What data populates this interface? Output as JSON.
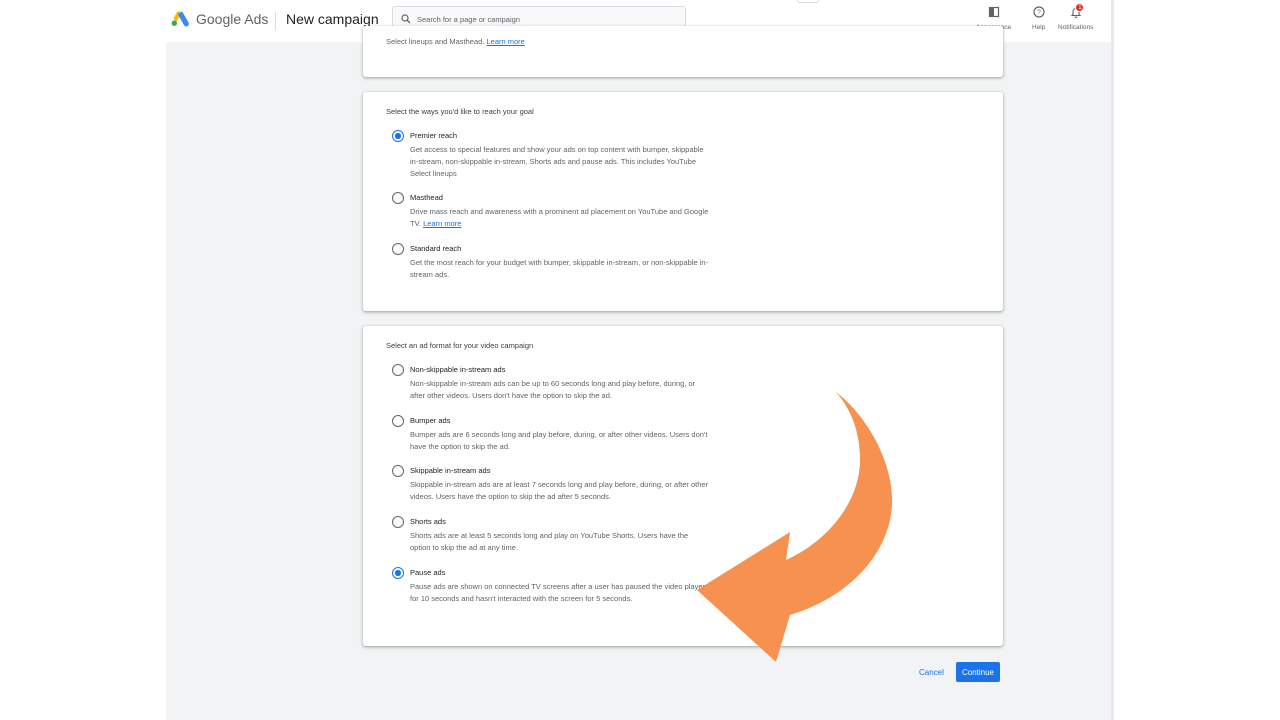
{
  "header": {
    "brand": "Google Ads",
    "page_title": "New campaign",
    "search_placeholder": "Search for a page or campaign",
    "tools": [
      {
        "label": "Appearance",
        "icon": "appearance-icon"
      },
      {
        "label": "Help",
        "icon": "help-icon"
      },
      {
        "label": "Notifications",
        "icon": "bell-icon",
        "badge": "1"
      }
    ]
  },
  "top_card": {
    "desc": "Select lineups and Masthead.",
    "link": "Learn more"
  },
  "reach": {
    "title": "Select the ways you'd like to reach your goal",
    "options": [
      {
        "label": "Premier reach",
        "desc": "Get access to special features and show your ads on top content with bumper, skippable in-stream, non-skippable in-stream, Shorts ads and pause ads. This includes YouTube Select lineups",
        "selected": true
      },
      {
        "label": "Masthead",
        "desc": "Drive mass reach and awareness with a prominent ad placement on YouTube and Google TV.",
        "link": "Learn more",
        "selected": false
      },
      {
        "label": "Standard reach",
        "desc": "Get the most reach for your budget with bumper, skippable in-stream, or non-skippable in-stream ads.",
        "selected": false
      }
    ]
  },
  "format": {
    "title": "Select an ad format for your video campaign",
    "options": [
      {
        "label": "Non-skippable in-stream ads",
        "desc": "Non-skippable in-stream ads can be up to 60 seconds long and play before, during, or after other videos. Users don't have the option to skip the ad.",
        "selected": false
      },
      {
        "label": "Bumper ads",
        "desc": "Bumper ads are 6 seconds long and play before, during, or after other videos. Users don't have the option to skip the ad.",
        "selected": false
      },
      {
        "label": "Skippable in-stream ads",
        "desc": "Skippable in-stream ads are at least 7 seconds long and play before, during, or after other videos. Users have the option to skip the ad after 5 seconds.",
        "selected": false
      },
      {
        "label": "Shorts ads",
        "desc": "Shorts ads are at least 5 seconds long and play on YouTube Shorts. Users have the option to skip the ad at any time.",
        "selected": false
      },
      {
        "label": "Pause ads",
        "desc": "Pause ads are shown on connected TV screens after a user has paused the video player for 10 seconds and hasn't interacted with the screen for 5 seconds.",
        "selected": true
      }
    ]
  },
  "actions": {
    "cancel": "Cancel",
    "continue": "Continue"
  },
  "colors": {
    "accent": "#1a73e8",
    "annotation_arrow": "#f6914f"
  }
}
